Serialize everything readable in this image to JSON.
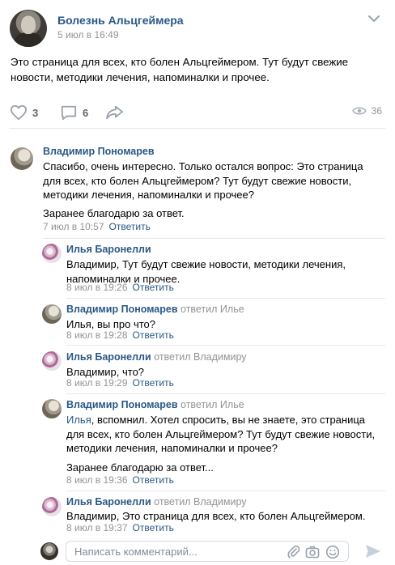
{
  "post": {
    "group_name": "Болезнь Альцгеймера",
    "time": "5 июл в 16:49",
    "text": "Это страница для всех, кто болен Альцгеймером. Тут будут свежие новости, методики лечения, напоминалки и прочее.",
    "likes": "3",
    "comments": "6",
    "views": "36"
  },
  "comments": [
    {
      "author": "Владимир Пономарев",
      "reply_to": "",
      "text": "Спасибо, очень интересно. Только остался вопрос: Это страница для всех, кто болен Альцгеймером? Тут будут свежие новости, методики лечения, напоминалки и прочее?",
      "text2": "Заранее благодарю за ответ.",
      "time": "7 июл в 10:57",
      "reply_label": "Ответить"
    },
    {
      "author": "Илья Баронелли",
      "reply_to": "",
      "text": "Владимир, Тут будут свежие новости, методики лечения, напоминалки и прочее.",
      "time": "8 июл в 19:26",
      "reply_label": "Ответить"
    },
    {
      "author": "Владимир Пономарев",
      "reply_to": "ответил Илье",
      "text": "Илья, вы про что?",
      "time": "8 июл в 19:28",
      "reply_label": "Ответить"
    },
    {
      "author": "Илья Баронелли",
      "reply_to": "ответил Владимиру",
      "text": "Владимир, что?",
      "time": "8 июл в 19:29",
      "reply_label": "Ответить"
    },
    {
      "author": "Владимир Пономарев",
      "reply_to": "ответил Илье",
      "mention": "Илья",
      "text": ", вспомнил. Хотел спросить, вы не знаете, это страница для всех, кто болен Альцгеймером? Тут будут свежие новости, методики лечения, напоминалки и прочее?",
      "text2": "Заранее благодарю за ответ...",
      "time": "8 июл в 19:36",
      "reply_label": "Ответить"
    },
    {
      "author": "Илья Баронелли",
      "reply_to": "ответил Владимиру",
      "text": "Владимир, Это страница для всех, кто болен Альцгеймером.",
      "time": "8 июл в 19:37",
      "reply_label": "Ответить"
    }
  ],
  "compose": {
    "placeholder": "Написать комментарий..."
  },
  "icons": {
    "more": "more-dots-icon",
    "like": "heart-icon",
    "comment": "comment-bubble-icon",
    "share": "share-arrow-icon",
    "views": "eye-icon",
    "attach": "paperclip-icon",
    "camera": "camera-icon",
    "smile": "smile-icon",
    "send": "send-icon"
  },
  "colors": {
    "link": "#2a5885",
    "muted": "#939393",
    "icon": "#99a2ad"
  }
}
